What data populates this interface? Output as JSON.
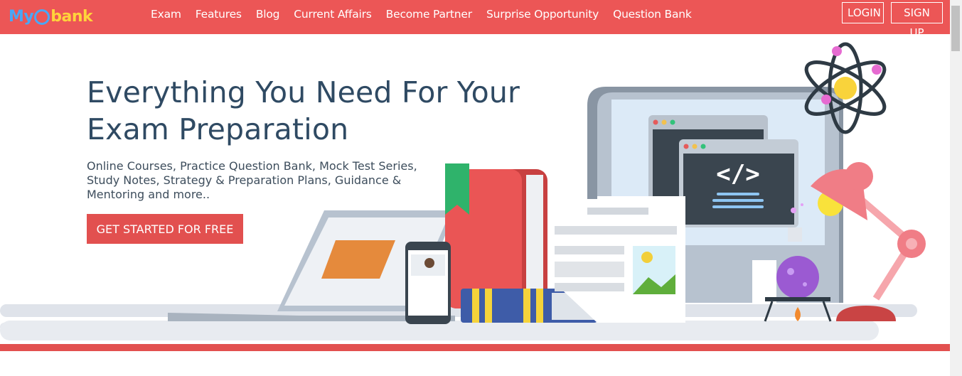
{
  "brand": {
    "logo_my": "My",
    "logo_bank": "bank"
  },
  "nav": [
    "Exam",
    "Features",
    "Blog",
    "Current Affairs",
    "Become Partner",
    "Surprise Opportunity",
    "Question Bank"
  ],
  "auth": {
    "login": "LOGIN",
    "signup": "SIGN UP"
  },
  "hero": {
    "title_line1": "Everything You Need For Your",
    "title_line2": "Exam Preparation",
    "subtitle": "Online Courses, Practice Question Bank, Mock Test Series, Study Notes, Strategy & Preparation Plans, Guidance & Mentoring and more..",
    "cta": "GET STARTED FOR FREE"
  },
  "illustration": {
    "code_symbol": "</>"
  },
  "colors": {
    "header_bg": "#ec5656",
    "accent": "#e2504f",
    "title": "#2f4a63",
    "logo_blue": "#4aa7f5",
    "logo_yellow": "#ffd43b"
  }
}
